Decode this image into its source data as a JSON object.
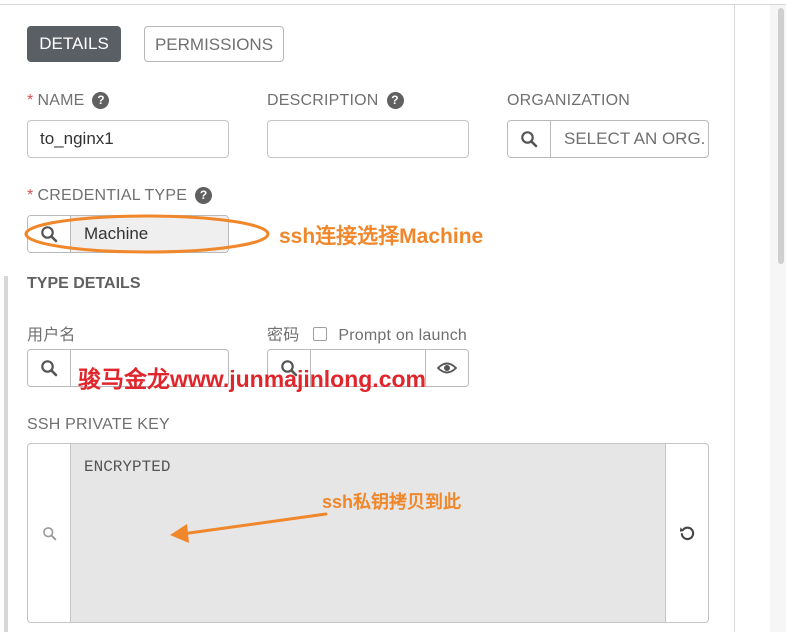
{
  "tabs": {
    "details": "DETAILS",
    "permissions": "PERMISSIONS"
  },
  "form": {
    "name_label": "NAME",
    "name_value": "to_nginx1",
    "description_label": "DESCRIPTION",
    "description_value": "",
    "organization_label": "ORGANIZATION",
    "organization_value": "SELECT AN ORG.",
    "credential_type_label": "CREDENTIAL TYPE",
    "credential_type_value": "Machine",
    "required_marker": "*"
  },
  "type_details": {
    "title": "TYPE DETAILS",
    "username_label": "用户名",
    "password_label": "密码",
    "prompt_on_launch_label": "Prompt on launch",
    "prompt_on_launch_checked": false
  },
  "ssh": {
    "label": "SSH PRIVATE KEY",
    "value": "ENCRYPTED"
  },
  "annotations": {
    "credential_type_note": "ssh连接选择Machine",
    "ssh_key_note": "ssh私钥拷贝到此",
    "watermark": "骏马金龙www.junmajinlong.com"
  },
  "colors": {
    "annotation": "#f0872b",
    "watermark": "#e0262c",
    "active_tab": "#5a5f66",
    "required": "#d9534f"
  },
  "icons": {
    "search": "search-icon",
    "help": "help-icon",
    "eye": "eye-icon",
    "reset": "reset-icon"
  }
}
